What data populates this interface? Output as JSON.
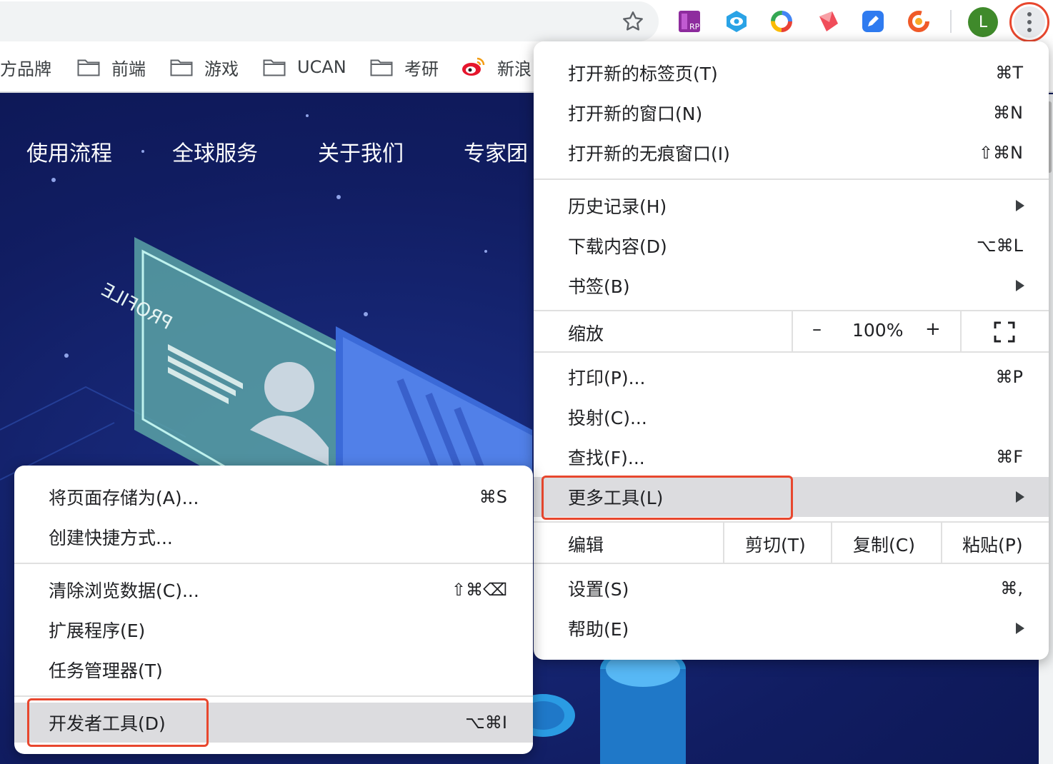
{
  "toolbar": {
    "profile_initial": "L",
    "extensions": [
      "rp-extension-icon",
      "eye-extension-icon",
      "color-ring-extension-icon",
      "red-shape-extension-icon",
      "blue-pen-extension-icon",
      "orange-ring-extension-icon"
    ]
  },
  "bookmarks": [
    {
      "label": "方品牌",
      "folder": false
    },
    {
      "label": "前端",
      "folder": true
    },
    {
      "label": "游戏",
      "folder": true
    },
    {
      "label": "UCAN",
      "folder": true
    },
    {
      "label": "考研",
      "folder": true
    },
    {
      "label": "新浪",
      "folder": false
    }
  ],
  "page": {
    "nav": [
      "使用流程",
      "全球服务",
      "关于我们",
      "专家团"
    ],
    "card_text": "PROFILE"
  },
  "main_menu": {
    "new_tab": {
      "label": "打开新的标签页(T)",
      "shortcut": "⌘T"
    },
    "new_window": {
      "label": "打开新的窗口(N)",
      "shortcut": "⌘N"
    },
    "incognito": {
      "label": "打开新的无痕窗口(I)",
      "shortcut": "⇧⌘N"
    },
    "history": {
      "label": "历史记录(H)"
    },
    "downloads": {
      "label": "下载内容(D)",
      "shortcut": "⌥⌘L"
    },
    "bookmarks": {
      "label": "书签(B)"
    },
    "zoom": {
      "label": "缩放",
      "minus": "–",
      "value": "100%",
      "plus": "+"
    },
    "print": {
      "label": "打印(P)...",
      "shortcut": "⌘P"
    },
    "cast": {
      "label": "投射(C)..."
    },
    "find": {
      "label": "查找(F)...",
      "shortcut": "⌘F"
    },
    "more_tools": {
      "label": "更多工具(L)"
    },
    "edit": {
      "label": "编辑",
      "cut": "剪切(T)",
      "copy": "复制(C)",
      "paste": "粘贴(P)"
    },
    "settings": {
      "label": "设置(S)",
      "shortcut": "⌘,"
    },
    "help": {
      "label": "帮助(E)"
    }
  },
  "sub_menu": {
    "save_page": {
      "label": "将页面存储为(A)...",
      "shortcut": "⌘S"
    },
    "create_shortcut": {
      "label": "创建快捷方式..."
    },
    "clear_data": {
      "label": "清除浏览数据(C)...",
      "shortcut": "⇧⌘⌫"
    },
    "extensions": {
      "label": "扩展程序(E)"
    },
    "task_manager": {
      "label": "任务管理器(T)"
    },
    "devtools": {
      "label": "开发者工具(D)",
      "shortcut": "⌥⌘I"
    }
  },
  "colors": {
    "accent_red": "#e8472e",
    "page_bg": "#111d62",
    "highlight": "#dcdcdf"
  }
}
